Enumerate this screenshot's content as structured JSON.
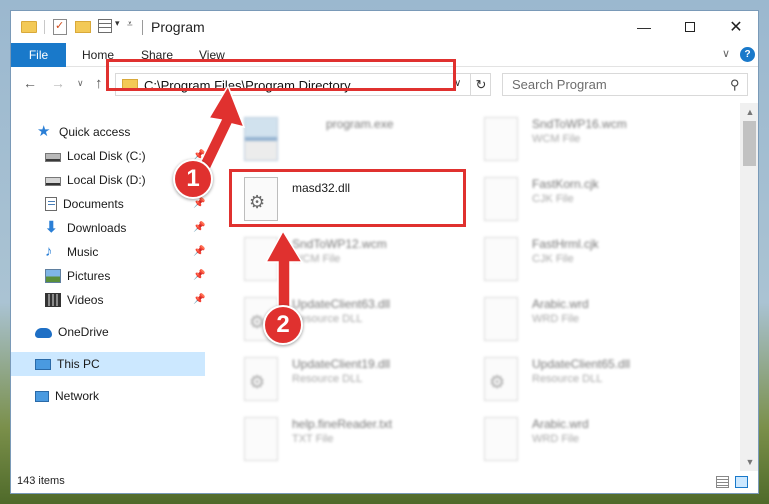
{
  "window": {
    "title": "Program",
    "controls": {
      "minimize": "—",
      "maximize": "",
      "close": "✕"
    }
  },
  "ribbon": {
    "file": "File",
    "home": "Home",
    "share": "Share",
    "view": "View",
    "help": "?"
  },
  "navigation": {
    "back": "←",
    "forward": "→",
    "up": "↑",
    "address": "C:\\Program Files\\Program Directory",
    "refresh": "↻",
    "search_placeholder": "Search Program"
  },
  "sidebar": {
    "quick_access": "Quick access",
    "items": [
      {
        "label": "Local Disk (C:)",
        "icon": "local-disk-icon",
        "pinned": true
      },
      {
        "label": "Local Disk (D:)",
        "icon": "local-disk-icon",
        "pinned": true
      },
      {
        "label": "Documents",
        "icon": "documents-icon",
        "pinned": true
      },
      {
        "label": "Downloads",
        "icon": "downloads-icon",
        "pinned": true
      },
      {
        "label": "Music",
        "icon": "music-icon",
        "pinned": true
      },
      {
        "label": "Pictures",
        "icon": "pictures-icon",
        "pinned": true
      },
      {
        "label": "Videos",
        "icon": "videos-icon",
        "pinned": true
      }
    ],
    "onedrive": "OneDrive",
    "this_pc": "This PC",
    "network": "Network"
  },
  "files": [
    {
      "name": "program.exe",
      "type": "",
      "icon": "exe-icon",
      "blurred": true
    },
    {
      "name": "SndToWP16.wcm",
      "type": "WCM File",
      "icon": "file-icon",
      "blurred": true
    },
    {
      "name": "masd32.dll",
      "type": "",
      "icon": "dll-gear-icon",
      "blurred": false
    },
    {
      "name": "FastKorn.cjk",
      "type": "CJK File",
      "icon": "file-icon",
      "blurred": true
    },
    {
      "name": "SndToWP12.wcm",
      "type": "WCM File",
      "icon": "file-icon",
      "blurred": true
    },
    {
      "name": "FastHrml.cjk",
      "type": "CJK File",
      "icon": "file-icon",
      "blurred": true
    },
    {
      "name": "UpdateClient63.dll",
      "type": "Resource DLL",
      "icon": "dll-gear-icon",
      "blurred": true
    },
    {
      "name": "Arabic.wrd",
      "type": "WRD File",
      "icon": "file-icon",
      "blurred": true
    },
    {
      "name": "UpdateClient19.dll",
      "type": "Resource DLL",
      "icon": "dll-gear-icon",
      "blurred": true
    },
    {
      "name": "UpdateClient65.dll",
      "type": "Resource DLL",
      "icon": "dll-gear-icon",
      "blurred": true
    },
    {
      "name": "help.fineReader.txt",
      "type": "TXT File",
      "icon": "file-icon",
      "blurred": true
    },
    {
      "name": "Arabic.wrd",
      "type": "WRD File",
      "icon": "file-icon",
      "blurred": true
    }
  ],
  "status": {
    "item_count": "143 items"
  },
  "callouts": {
    "step1": "1",
    "step2": "2"
  },
  "colors": {
    "accent": "#1979ca",
    "highlight": "#e0312f",
    "selected": "#cce8ff"
  }
}
